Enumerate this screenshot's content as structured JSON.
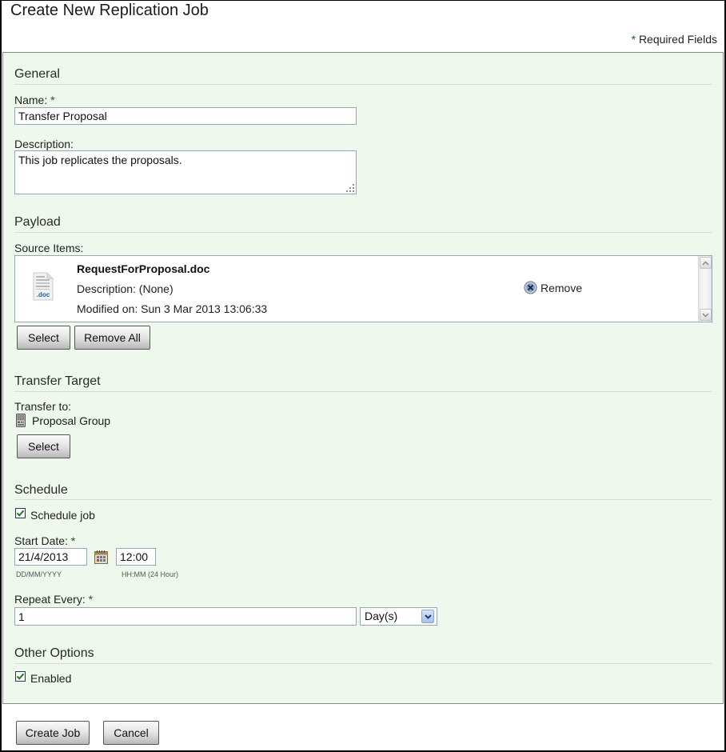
{
  "page": {
    "title": "Create New Replication Job",
    "required_star": "*",
    "required_note": "Required Fields"
  },
  "general": {
    "section_title": "General",
    "name_label": "Name:",
    "name_required": "*",
    "name_value": "Transfer Proposal",
    "description_label": "Description:",
    "description_value": "This job replicates the proposals."
  },
  "payload": {
    "section_title": "Payload",
    "source_items_label": "Source Items:",
    "items": [
      {
        "icon": "doc-file-icon",
        "icon_text": ".doc",
        "name": "RequestForProposal.doc",
        "description": "Description: (None)",
        "modified": "Modified on: Sun 3 Mar 2013 13:06:33",
        "remove_label": "Remove"
      }
    ],
    "select_label": "Select",
    "remove_all_label": "Remove All"
  },
  "transfer_target": {
    "section_title": "Transfer Target",
    "transfer_to_label": "Transfer to:",
    "target_icon": "server-icon",
    "target_name": "Proposal Group",
    "select_label": "Select"
  },
  "schedule": {
    "section_title": "Schedule",
    "schedule_job_label": "Schedule job",
    "schedule_job_checked": true,
    "start_date_label": "Start Date:",
    "start_date_required": "*",
    "start_date_value": "21/4/2013",
    "date_format_hint": "DD/MM/YYYY",
    "time_value": "12:00",
    "time_format_hint": "HH:MM (24 Hour)",
    "repeat_label": "Repeat Every:",
    "repeat_required": "*",
    "repeat_value": "1",
    "repeat_unit": "Day(s)"
  },
  "other_options": {
    "section_title": "Other Options",
    "enabled_label": "Enabled",
    "enabled_checked": true
  },
  "footer": {
    "create_label": "Create Job",
    "cancel_label": "Cancel"
  },
  "colors": {
    "panel_bg": "#eff8ec",
    "required_star": "#1d5c1d",
    "check_mark": "#1f7a1f"
  }
}
